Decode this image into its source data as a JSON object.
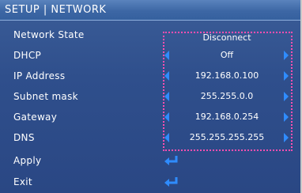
{
  "title": "SETUP | NETWORK",
  "rows": [
    {
      "label": "Network State",
      "value": "Disconnect"
    },
    {
      "label": "DHCP",
      "value": "Off"
    },
    {
      "label": "IP Address",
      "value": "192.168.0.100"
    },
    {
      "label": "Subnet mask",
      "value": "255.255.0.0"
    },
    {
      "label": "Gateway",
      "value": "192.168.0.254"
    },
    {
      "label": "DNS",
      "value": "255.255.255.255"
    },
    {
      "label": "Apply"
    },
    {
      "label": "Exit"
    }
  ],
  "icons": {
    "left_arrow": "triangle-left-icon",
    "right_arrow": "triangle-right-icon",
    "enter": "enter-arrow-icon"
  },
  "colors": {
    "accent_arrow": "#2f8cff",
    "selection_border": "#ff4fb0",
    "background": "#2f4f8c"
  }
}
